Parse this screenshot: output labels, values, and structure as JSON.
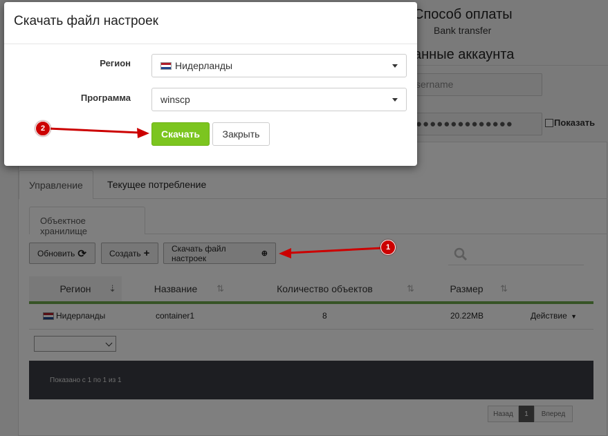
{
  "payment": {
    "title": "Способ оплаты",
    "value": "Bank transfer"
  },
  "account": {
    "title": "анные аккаунта",
    "username": "sername",
    "password": "●●●●●●●●●●●●●●",
    "show_label": "Показать"
  },
  "tabs": [
    {
      "label": "Управление"
    },
    {
      "label": "Текущее потребление"
    }
  ],
  "subtab": {
    "label": "Объектное хранилище"
  },
  "toolbar": {
    "refresh_label": "Обновить",
    "create_label": "Создать",
    "download_label": "Скачать файл настроек"
  },
  "table": {
    "headers": [
      "Регион",
      "Название",
      "Количество объектов",
      "Размер"
    ],
    "rows": [
      {
        "region": "Нидерланды",
        "name": "container1",
        "count": "8",
        "size": "20.22MB",
        "action": "Действие"
      }
    ],
    "footer_text": "Показано с 1 по 1 из 1"
  },
  "pagination": {
    "prev": "Назад",
    "current": "1",
    "next": "Вперед"
  },
  "modal": {
    "title": "Скачать файл настроек",
    "region_label": "Регион",
    "region_value": "Нидерланды",
    "program_label": "Программа",
    "program_value": "winscp",
    "download_button": "Скачать",
    "close_button": "Закрыть"
  },
  "annotations": {
    "badge1": "1",
    "badge2": "2"
  },
  "colors": {
    "accent_green": "#7cc51f",
    "header_underline": "#6fa84c",
    "annotation_red": "#cc0000",
    "footer_bg": "#3a3d45"
  }
}
